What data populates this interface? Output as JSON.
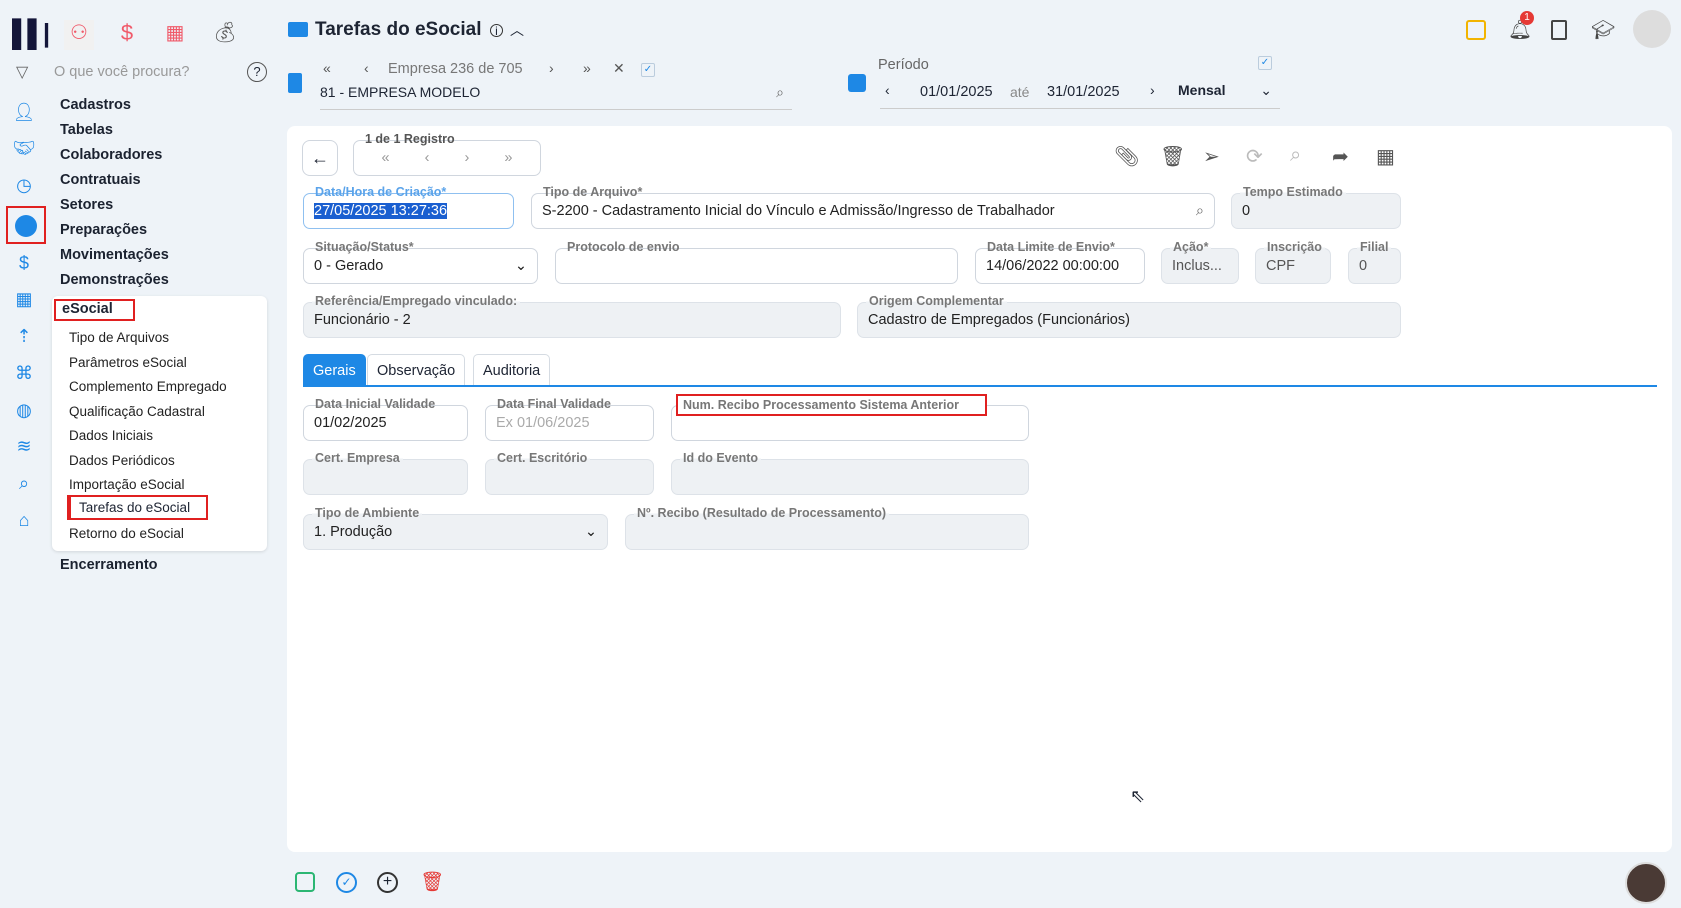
{
  "app": {
    "title": "Tarefas do eSocial",
    "search_placeholder": "O que você procura?"
  },
  "top_icons": [
    "people-icon",
    "dollar-icon",
    "calculator-icon",
    "money-bag-icon"
  ],
  "company_nav": {
    "label": "Empresa 236 de 705",
    "value": "81 - EMPRESA MODELO"
  },
  "period": {
    "label": "Período",
    "start": "01/01/2025",
    "sep": "até",
    "end": "31/01/2025",
    "mode": "Mensal"
  },
  "notifications": {
    "count": "1"
  },
  "menu": [
    "Cadastros",
    "Tabelas",
    "Colaboradores",
    "Contratuais",
    "Setores",
    "Preparações",
    "Movimentações",
    "Demonstrações"
  ],
  "esocial": {
    "title": "eSocial",
    "items": [
      "Tipo de Arquivos",
      "Parâmetros eSocial",
      "Complemento Empregado",
      "Qualificação Cadastral",
      "Dados Iniciais",
      "Dados Periódicos",
      "Importação eSocial",
      "Tarefas do eSocial",
      "Retorno do eSocial"
    ]
  },
  "menu_last": "Encerramento",
  "record_nav": {
    "label": "1 de 1 Registro"
  },
  "fields": {
    "data_hora": {
      "label": "Data/Hora de Criação*",
      "value": "27/05/2025 13:27:36"
    },
    "tipo_arquivo": {
      "label": "Tipo de Arquivo*",
      "value": "S-2200 - Cadastramento Inicial do Vínculo e Admissão/Ingresso de Trabalhador"
    },
    "tempo": {
      "label": "Tempo Estimado",
      "value": "0"
    },
    "situacao": {
      "label": "Situação/Status*",
      "value": "0 - Gerado"
    },
    "protocolo": {
      "label": "Protocolo de envio",
      "value": ""
    },
    "data_limite": {
      "label": "Data Limite de Envio*",
      "value": "14/06/2022 00:00:00"
    },
    "acao": {
      "label": "Ação*",
      "value": "Inclus..."
    },
    "inscricao": {
      "label": "Inscrição",
      "value": "CPF"
    },
    "filial": {
      "label": "Filial",
      "value": "0"
    },
    "referencia": {
      "label": "Referência/Empregado vinculado:",
      "value": "Funcionário - 2"
    },
    "origem": {
      "label": "Origem Complementar",
      "value": "Cadastro de Empregados (Funcionários)"
    }
  },
  "tabs": [
    "Gerais",
    "Observação",
    "Auditoria"
  ],
  "gerais": {
    "data_inicial": {
      "label": "Data Inicial Validade",
      "value": "01/02/2025"
    },
    "data_final": {
      "label": "Data Final Validade",
      "placeholder": "Ex 01/06/2025"
    },
    "num_recibo": {
      "label": "Num. Recibo Processamento Sistema Anterior",
      "value": ""
    },
    "cert_empresa": {
      "label": "Cert. Empresa",
      "value": ""
    },
    "cert_escritorio": {
      "label": "Cert. Escritório",
      "value": ""
    },
    "id_evento": {
      "label": "Id do Evento",
      "value": ""
    },
    "tipo_ambiente": {
      "label": "Tipo de Ambiente",
      "value": "1. Produção"
    },
    "n_recibo": {
      "label": "Nº. Recibo (Resultado de Processamento)",
      "value": ""
    }
  }
}
